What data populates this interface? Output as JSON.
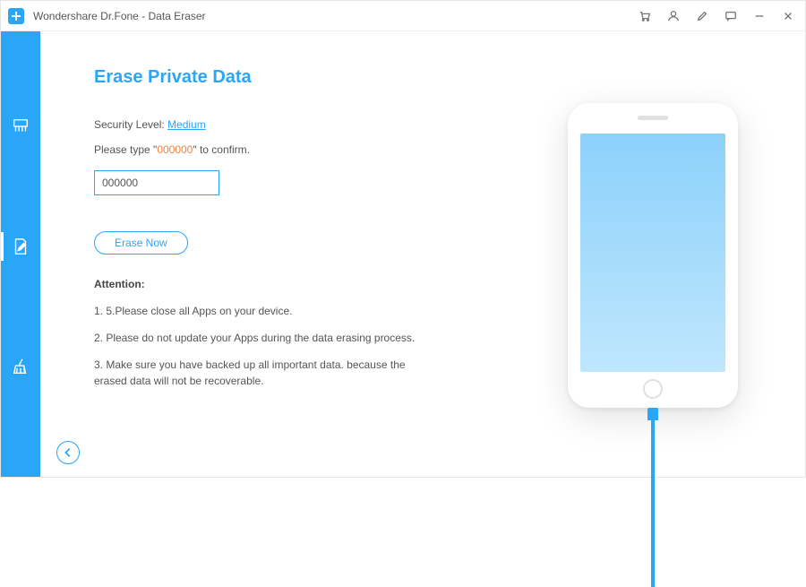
{
  "window": {
    "title": "Wondershare Dr.Fone - Data Eraser"
  },
  "sidebar": {
    "items": [
      {
        "name": "shredder-icon"
      },
      {
        "name": "erase-icon"
      },
      {
        "name": "broom-icon"
      }
    ]
  },
  "main": {
    "heading": "Erase Private Data",
    "security_label": "Security Level: ",
    "security_value": "Medium",
    "confirm_prefix": "Please type \"",
    "confirm_code": "000000",
    "confirm_suffix": "\" to confirm.",
    "input_value": "000000",
    "erase_button": "Erase Now",
    "attention_heading": "Attention:",
    "attention_items": [
      "1. 5.Please close all Apps on your device.",
      "2. Please do not update your Apps during the data erasing process.",
      "3. Make sure you have backed up all important data. because the erased data will not be recoverable."
    ]
  }
}
